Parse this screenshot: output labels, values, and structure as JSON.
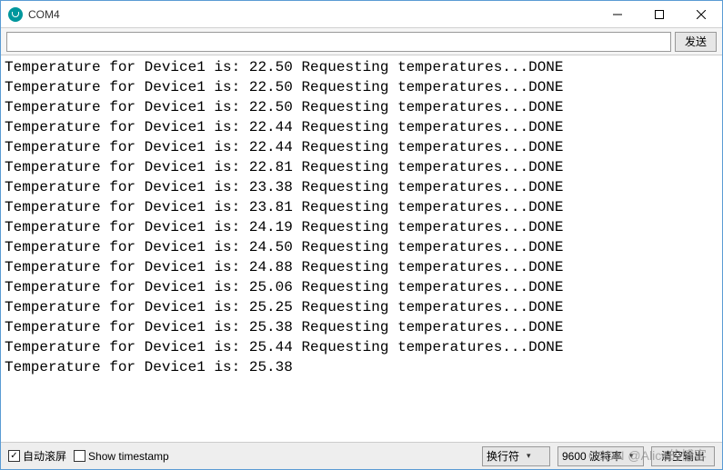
{
  "window": {
    "title": "COM4"
  },
  "toolbar": {
    "send_label": "发送",
    "input_value": ""
  },
  "console": {
    "lines": [
      "Temperature for Device1 is: 22.50 Requesting temperatures...DONE",
      "Temperature for Device1 is: 22.50 Requesting temperatures...DONE",
      "Temperature for Device1 is: 22.50 Requesting temperatures...DONE",
      "Temperature for Device1 is: 22.44 Requesting temperatures...DONE",
      "Temperature for Device1 is: 22.44 Requesting temperatures...DONE",
      "Temperature for Device1 is: 22.81 Requesting temperatures...DONE",
      "Temperature for Device1 is: 23.38 Requesting temperatures...DONE",
      "Temperature for Device1 is: 23.81 Requesting temperatures...DONE",
      "Temperature for Device1 is: 24.19 Requesting temperatures...DONE",
      "Temperature for Device1 is: 24.50 Requesting temperatures...DONE",
      "Temperature for Device1 is: 24.88 Requesting temperatures...DONE",
      "Temperature for Device1 is: 25.06 Requesting temperatures...DONE",
      "Temperature for Device1 is: 25.25 Requesting temperatures...DONE",
      "Temperature for Device1 is: 25.38 Requesting temperatures...DONE",
      "Temperature for Device1 is: 25.44 Requesting temperatures...DONE",
      "Temperature for Device1 is: 25.38 "
    ]
  },
  "footer": {
    "autoscroll_label": "自动滚屏",
    "autoscroll_checked": true,
    "timestamp_label": "Show timestamp",
    "timestamp_checked": false,
    "line_ending_selected": "换行符",
    "baud_selected": "9600 波特率",
    "clear_label": "清空输出"
  },
  "watermark": "CSDN @Alice的博客"
}
